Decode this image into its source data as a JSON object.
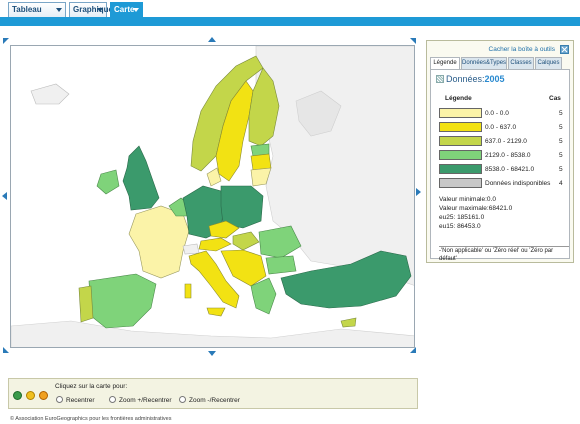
{
  "top_tabs": [
    {
      "label": "Tableau"
    },
    {
      "label": "Graphique"
    },
    {
      "label": "Carte"
    }
  ],
  "panel": {
    "hide_tools": "Cacher la boîte à outils",
    "tabs": [
      {
        "label": "Légende"
      },
      {
        "label": "Données&Types"
      },
      {
        "label": "Classes"
      },
      {
        "label": "Calques"
      }
    ],
    "title_prefix": "Données:",
    "year": "2005",
    "legend_header": "Légende",
    "count_header": "Cas",
    "classes": [
      {
        "label": "0.0 - 0.0",
        "count": "5",
        "color": "#fbf3a8"
      },
      {
        "label": "0.0 - 637.0",
        "count": "5",
        "color": "#f2e213"
      },
      {
        "label": "637.0 - 2129.0",
        "count": "5",
        "color": "#c3d64a"
      },
      {
        "label": "2129.0 - 8538.0",
        "count": "5",
        "color": "#7fd37a"
      },
      {
        "label": "8538.0 - 68421.0",
        "count": "5",
        "color": "#3b9a6c"
      },
      {
        "label": "Données indisponibles",
        "count": "4",
        "color": "#c8c8c8"
      }
    ],
    "stats": [
      "Valeur minimale:0.0",
      "Valeur maximale:68421.0",
      "eu25: 185161.0",
      "eu15: 86453.0"
    ],
    "note": "-'Non applicable' ou 'Zéro réel' ou 'Zéro par défaut'"
  },
  "tools": {
    "prompt": "Cliquez sur la carte pour:",
    "options": [
      {
        "label": "Recentrer"
      },
      {
        "label": "Zoom +/Recentrer"
      },
      {
        "label": "Zoom -/Recentrer"
      }
    ]
  },
  "footer": "© Association EuroGeographics pour les frontières administratives"
}
